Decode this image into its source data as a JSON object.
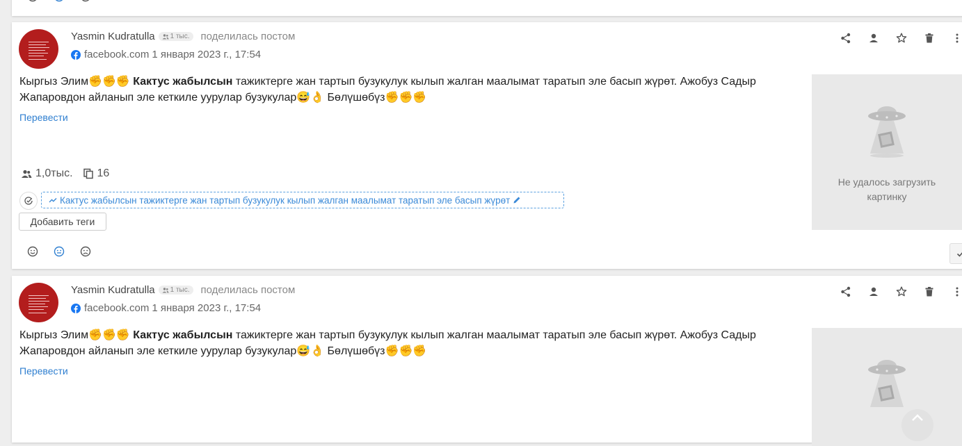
{
  "posts": [
    {
      "author": "Yasmin Kudratulla",
      "followers_badge": "1 тыс.",
      "action_text": "поделилась постом",
      "source": "facebook.com",
      "date": "1 января 2023 г., 17:54",
      "text_before": "Кыргыз Элим",
      "text_bold": "Кактус жабылсын",
      "text_after": " тажиктерге жан тартып бузукулук кылып жалган маалымат таратып эле басып жүрөт. Ажобуз Садыр Жапаровдон айланып эле кеткиле уурулар бузукулар",
      "text_end": " Бөлүшөбүз",
      "translate_label": "Перевести",
      "reach": "1,0тыс.",
      "copies": "16",
      "highlight": "Кактус жабылсын тажиктерге жан тартып бузукулук кылып жалган маалымат таратып эле басып жүрөт",
      "add_tags_label": "Добавить теги",
      "image_error": [
        "Не удалось загрузить",
        "картинку"
      ]
    },
    {
      "author": "Yasmin Kudratulla",
      "followers_badge": "1 тыс.",
      "action_text": "поделилась постом",
      "source": "facebook.com",
      "date": "1 января 2023 г., 17:54",
      "text_before": "Кыргыз Элим",
      "text_bold": "Кактус жабылсын",
      "text_after": " тажиктерге жан тартып бузукулук кылып жалган маалымат таратып эле басып жүрөт. Ажобуз Садыр Жапаровдон айланып эле кеткиле уурулар бузукулар",
      "text_end": " Бөлүшөбүз",
      "translate_label": "Перевести"
    }
  ],
  "colors": {
    "accent": "#2f7fd0",
    "avatar": "#b31d1d",
    "facebook": "#1877f2",
    "neutral": "#555555"
  },
  "icons": [
    "smile-icon",
    "neutral-face-icon",
    "share-icon",
    "person-icon",
    "star-icon",
    "trash-icon",
    "more-vert-icon",
    "people-icon",
    "copy-icon",
    "check-icon",
    "trend-icon",
    "pencil-icon",
    "ufo-icon",
    "chevron-up-icon"
  ]
}
